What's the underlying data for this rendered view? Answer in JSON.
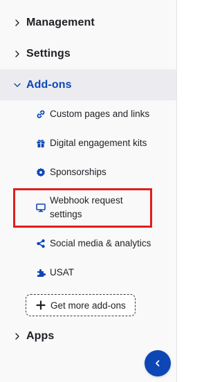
{
  "sidebar": {
    "sections": [
      {
        "label": "Management",
        "expanded": false
      },
      {
        "label": "Settings",
        "expanded": false
      },
      {
        "label": "Add-ons",
        "expanded": true
      },
      {
        "label": "Apps",
        "expanded": false
      }
    ],
    "addons": [
      {
        "label": "Custom pages and links",
        "icon": "link-icon"
      },
      {
        "label": "Digital engagement kits",
        "icon": "gift-icon"
      },
      {
        "label": "Sponsorships",
        "icon": "badge-icon"
      },
      {
        "label_line1": "Webhook request",
        "label_line2": "settings",
        "icon": "monitor-icon",
        "highlighted": true
      },
      {
        "label": "Social media & analytics",
        "icon": "share-icon"
      },
      {
        "label": "USAT",
        "icon": "puzzle-icon"
      }
    ],
    "get_more_label": "Get more add-ons"
  },
  "colors": {
    "accent": "#0d46b5",
    "active_bg": "#ececf0",
    "highlight": "#e11d1d",
    "text": "#1f1f24"
  }
}
